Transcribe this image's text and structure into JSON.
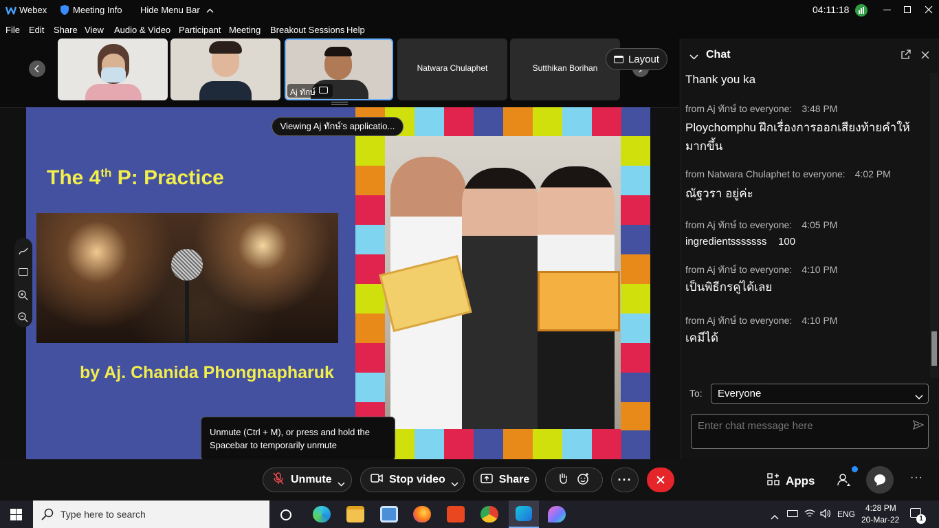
{
  "titlebar": {
    "app_name": "Webex",
    "meeting_info": "Meeting Info",
    "hide_menu_bar": "Hide Menu Bar",
    "clock": "04:11:18"
  },
  "menu": {
    "items": [
      "File",
      "Edit",
      "Share",
      "View",
      "Audio & Video",
      "Participant",
      "Meeting",
      "Breakout Sessions",
      "Help"
    ]
  },
  "participants": {
    "thumbs": [
      {
        "name": ""
      },
      {
        "name": ""
      },
      {
        "name": "Aj ทักษ์"
      },
      {
        "name": "Natwara Chulaphet"
      },
      {
        "name": "Sutthikan Borihan"
      }
    ],
    "layout_label": "Layout"
  },
  "stage": {
    "viewing_label": "Viewing Aj ทักษ์'s applicatio...",
    "slide_title_pre": "The 4",
    "slide_title_sup": "th",
    "slide_title_post": " P: Practice",
    "slide_author": "by Aj. Chanida Phongnapharuk",
    "tooltip": "Unmute (Ctrl + M), or press and hold the Spacebar to temporarily unmute"
  },
  "chat": {
    "title": "Chat",
    "messages": [
      {
        "head": "",
        "time": "",
        "body": "Thank you ka"
      },
      {
        "head": "from Aj ทักษ์ to everyone:",
        "time": "3:48 PM",
        "body": "Ploychomphu ฝึกเรื่องการออกเสียงท้ายคำให้มากขึ้น"
      },
      {
        "head": "from Natwara Chulaphet to everyone:",
        "time": "4:02 PM",
        "body": "ณัฐวรา อยู่ค่ะ"
      },
      {
        "head": "from Aj ทักษ์ to everyone:",
        "time": "4:05 PM",
        "body": "ingredientsssssss    100"
      },
      {
        "head": "from Aj ทักษ์ to everyone:",
        "time": "4:10 PM",
        "body": "เป็นพิธีกรคู่ได้เลย"
      },
      {
        "head": "from Aj ทักษ์ to everyone:",
        "time": "4:10 PM",
        "body": "เคมีได้"
      }
    ],
    "to_label": "To:",
    "to_value": "Everyone",
    "input_placeholder": "Enter chat message here"
  },
  "controls": {
    "unmute": "Unmute",
    "stop_video": "Stop video",
    "share": "Share",
    "apps": "Apps"
  },
  "taskbar": {
    "search_placeholder": "Type here to search",
    "lang": "ENG",
    "time": "4:28 PM",
    "date": "20-Mar-22",
    "notif_count": "1"
  },
  "colors": {
    "slide_bg": "#4450a0",
    "slide_text": "#f2ee4c",
    "end_button": "#e5252a",
    "accent_border": "#6ab0ff"
  }
}
